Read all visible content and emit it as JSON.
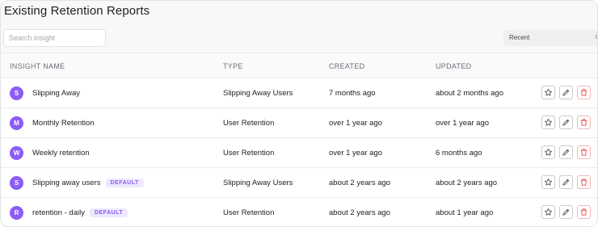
{
  "page": {
    "title": "Existing Retention Reports"
  },
  "search": {
    "placeholder": "Search insight",
    "value": ""
  },
  "sort": {
    "selected": "Recent"
  },
  "columns": {
    "name": "INSIGHT NAME",
    "type": "TYPE",
    "created": "CREATED",
    "updated": "UPDATED"
  },
  "rows": [
    {
      "initial": "S",
      "name": "Slipping Away",
      "badge": "",
      "type": "Slipping Away Users",
      "created": "7 months ago",
      "updated": "about 2 months ago"
    },
    {
      "initial": "M",
      "name": "Monthly Retention",
      "badge": "",
      "type": "User Retention",
      "created": "over 1 year ago",
      "updated": "over 1 year ago"
    },
    {
      "initial": "W",
      "name": "Weekly retention",
      "badge": "",
      "type": "User Retention",
      "created": "over 1 year ago",
      "updated": "6 months ago"
    },
    {
      "initial": "S",
      "name": "Slipping away users",
      "badge": "DEFAULT",
      "type": "Slipping Away Users",
      "created": "about 2 years ago",
      "updated": "about 2 years ago"
    },
    {
      "initial": "R",
      "name": "retention - daily",
      "badge": "DEFAULT",
      "type": "User Retention",
      "created": "about 2 years ago",
      "updated": "about 1 year ago"
    }
  ],
  "icons": {
    "favorite": "star-icon",
    "edit": "pencil-icon",
    "delete": "trash-icon"
  },
  "colors": {
    "accent": "#8b5cf6",
    "badge_bg": "#ede8fd",
    "delete": "#e5484d"
  }
}
